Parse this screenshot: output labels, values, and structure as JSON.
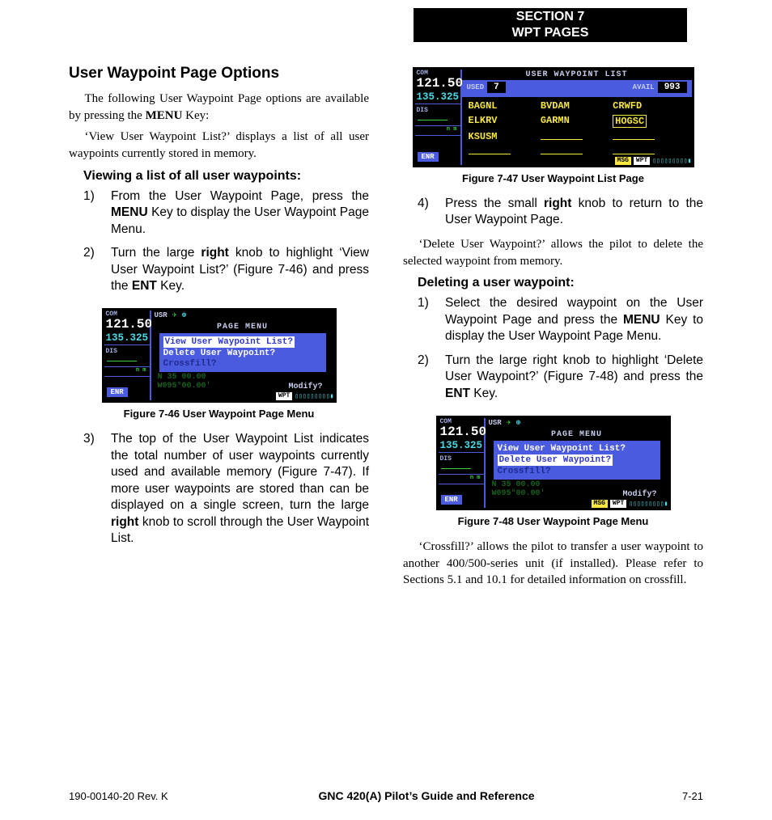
{
  "header": {
    "line1": "SECTION 7",
    "line2": "WPT PAGES"
  },
  "left": {
    "h2": "User Waypoint Page Options",
    "intro1a": "The following User Waypoint Page options are available by pressing the ",
    "intro1b": "MENU",
    "intro1c": " Key:",
    "intro2": "‘View User Waypoint List?’ displays a list of all user waypoints currently stored in memory.",
    "h3": "Viewing a list of all user waypoints:",
    "steps": [
      {
        "n": "1)",
        "pre": "From the User Waypoint Page, press the ",
        "b": "MENU",
        "post": " Key to display the User Waypoint Page Menu."
      },
      {
        "n": "2)",
        "pre": "Turn the large ",
        "b": "right",
        "mid": " knob to highlight ‘View User Waypoint List?’ (Figure 7-46) and press the ",
        "b2": "ENT",
        "post2": " Key."
      }
    ],
    "fig46": {
      "caption": "Figure 7-46  User Waypoint Page Menu",
      "com": "COM",
      "freq_active": "121.500",
      "freq_standby": "135.325",
      "dis": "DIS",
      "nm": "n m",
      "enr": "ENR",
      "usr": "USR",
      "page_menu": "PAGE MENU",
      "menu_hl": "View User Waypoint List?",
      "menu_2": "Delete User Waypoint?",
      "menu_3": "Crossfill?",
      "modify": "Modify?",
      "coord1": "N 35 00.00",
      "coord2": "W095°00.00'",
      "wpt": "WPT"
    },
    "step3": {
      "n": "3)",
      "pre": "The top of the User Waypoint List indicates the total number of user waypoints currently used and available memory (Figure 7-47).  If more user waypoints are stored than can be displayed on a single screen, turn the large ",
      "b": "right",
      "post": " knob to scroll through the User Waypoint List."
    }
  },
  "right": {
    "fig47": {
      "caption": "Figure 7-47  User Waypoint List Page",
      "title": "USER WAYPOINT LIST",
      "com": "COM",
      "freq_active": "121.500",
      "freq_standby": "135.325",
      "dis": "DIS",
      "nm": "n m",
      "enr": "ENR",
      "used": "USED",
      "used_n": "7",
      "avail": "AVAIL",
      "avail_n": "993",
      "cells": [
        "BAGNL",
        "BVDAM",
        "CRWFD",
        "ELKRV",
        "GARMN",
        "HOGSC",
        "KSUSM"
      ],
      "msg": "MSG",
      "wpt": "WPT"
    },
    "step4": {
      "n": "4)",
      "pre": "Press the small ",
      "b": "right",
      "post": " knob to return to the User Waypoint Page."
    },
    "para_del": "‘Delete User Waypoint?’ allows the pilot to delete the selected waypoint from memory.",
    "h3": "Deleting a user waypoint:",
    "dsteps": [
      {
        "n": "1)",
        "pre": "Select the desired waypoint on the User Waypoint Page and press the ",
        "b": "MENU",
        "post": " Key to display the User Waypoint Page Menu."
      },
      {
        "n": "2)",
        "pre": "Turn the large right knob to highlight ‘Delete User Waypoint?’ (Figure 7-48) and press the ",
        "b": "ENT",
        "post": " Key."
      }
    ],
    "fig48": {
      "caption": "Figure 7-48  User Waypoint Page Menu",
      "com": "COM",
      "freq_active": "121.500",
      "freq_standby": "135.325",
      "dis": "DIS",
      "nm": "n m",
      "enr": "ENR",
      "usr": "USR",
      "page_menu": "PAGE MENU",
      "menu_1": "View User Waypoint List?",
      "menu_hl": "Delete User Waypoint?",
      "menu_3": "Crossfill?",
      "modify": "Modify?",
      "coord1": "N 35 00.00",
      "coord2": "W095°00.00'",
      "msg": "MSG",
      "wpt": "WPT"
    },
    "para_cf": "‘Crossfill?’ allows the pilot to transfer a user waypoint to another 400/500-series unit (if installed).  Please refer to Sections 5.1 and 10.1 for detailed information on crossfill."
  },
  "footer": {
    "left": "190-00140-20  Rev. K",
    "center": "GNC 420(A) Pilot’s Guide and Reference",
    "right": "7-21"
  }
}
